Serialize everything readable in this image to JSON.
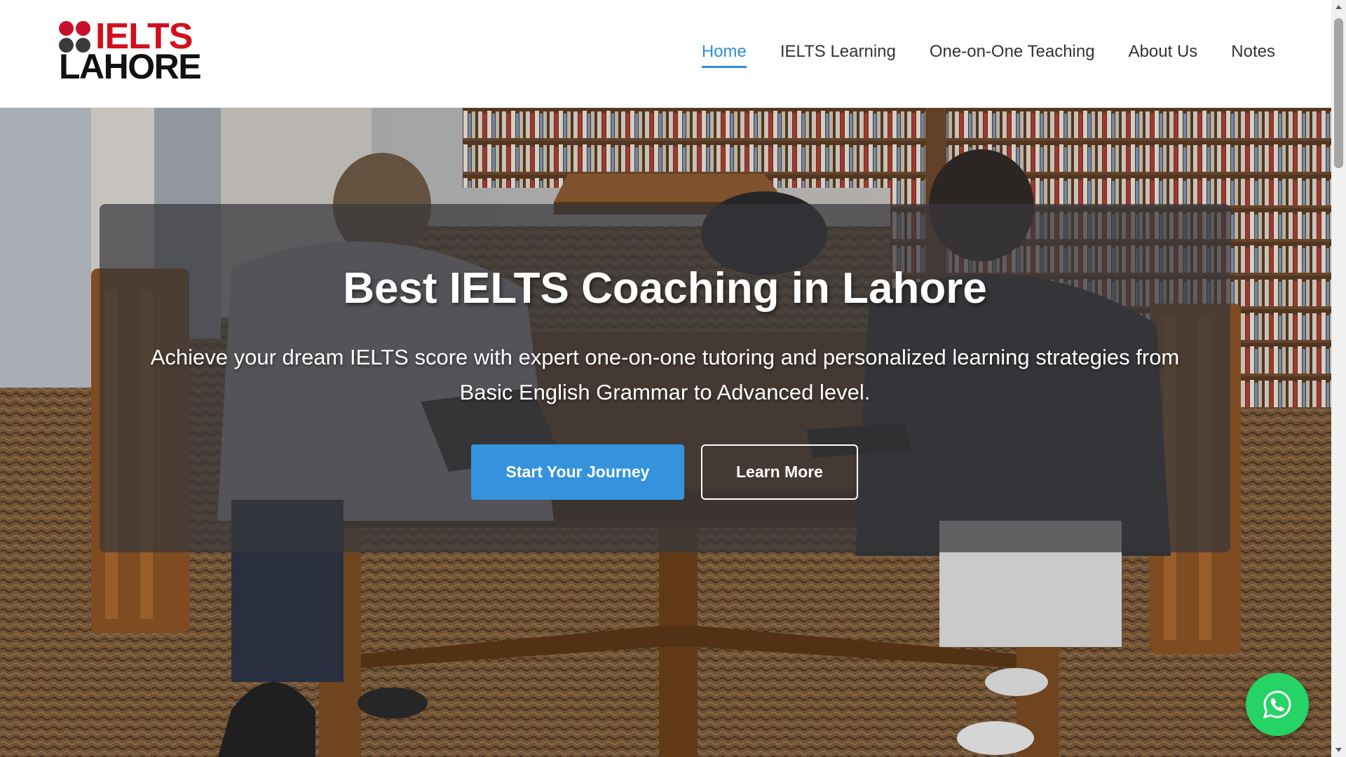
{
  "brand": {
    "line1": "IELTS",
    "line2": "LAHORE",
    "accent_color": "#d40f1c"
  },
  "nav": {
    "items": [
      {
        "label": "Home",
        "active": true
      },
      {
        "label": "IELTS Learning",
        "active": false
      },
      {
        "label": "One-on-One Teaching",
        "active": false
      },
      {
        "label": "About Us",
        "active": false
      },
      {
        "label": "Notes",
        "active": false
      }
    ],
    "active_color": "#2f8fd8"
  },
  "hero": {
    "title": "Best IELTS Coaching in Lahore",
    "subtitle": "Achieve your dream IELTS score with expert one-on-one tutoring and personalized learning strategies from Basic English Grammar to Advanced level.",
    "primary_button": "Start Your Journey",
    "secondary_button": "Learn More",
    "primary_color": "#3593dd"
  },
  "floating": {
    "whatsapp_icon": "whatsapp-icon",
    "color": "#25d366"
  }
}
